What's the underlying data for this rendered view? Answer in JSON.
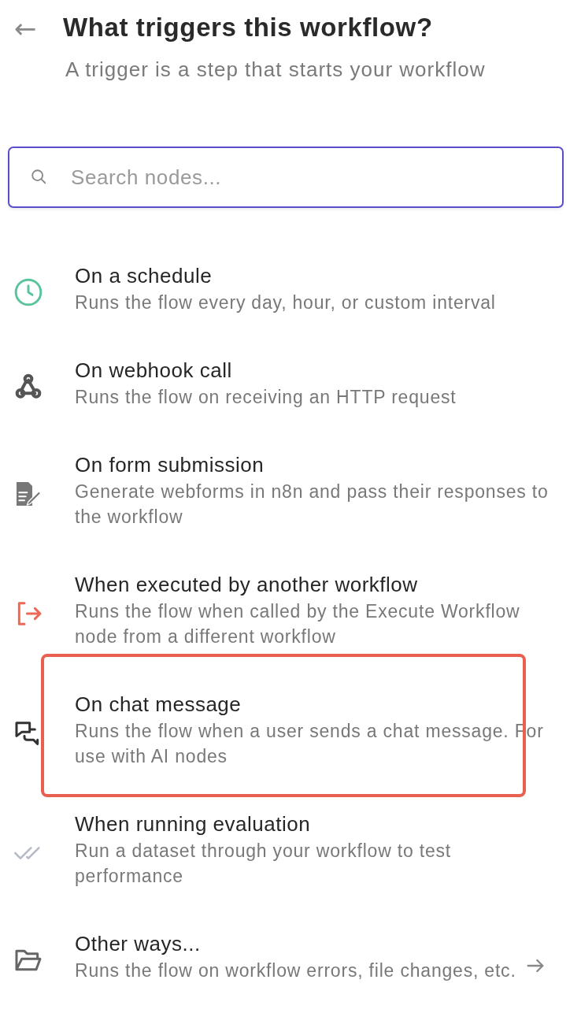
{
  "header": {
    "back": "←",
    "title": "What triggers this workflow?",
    "subtitle": "A trigger is a step that starts your workflow"
  },
  "search": {
    "placeholder": "Search nodes..."
  },
  "triggers": [
    {
      "title": "On a schedule",
      "description": "Runs the flow every day, hour, or custom interval",
      "highlighted": false,
      "has_arrow": false
    },
    {
      "title": "On webhook call",
      "description": "Runs the flow on receiving an HTTP request",
      "highlighted": false,
      "has_arrow": false
    },
    {
      "title": "On form submission",
      "description": "Generate webforms in n8n and pass their responses to the workflow",
      "highlighted": false,
      "has_arrow": false
    },
    {
      "title": "When executed by another workflow",
      "description": "Runs the flow when called by the Execute Workflow node from a different workflow",
      "highlighted": false,
      "has_arrow": false
    },
    {
      "title": "On chat message",
      "description": "Runs the flow when a user sends a chat message. For use with AI nodes",
      "highlighted": true,
      "has_arrow": false
    },
    {
      "title": "When running evaluation",
      "description": "Run a dataset through your workflow to test performance",
      "highlighted": false,
      "has_arrow": false
    },
    {
      "title": "Other ways...",
      "description": "Runs the flow on workflow errors, file changes, etc.",
      "highlighted": false,
      "has_arrow": true
    }
  ]
}
